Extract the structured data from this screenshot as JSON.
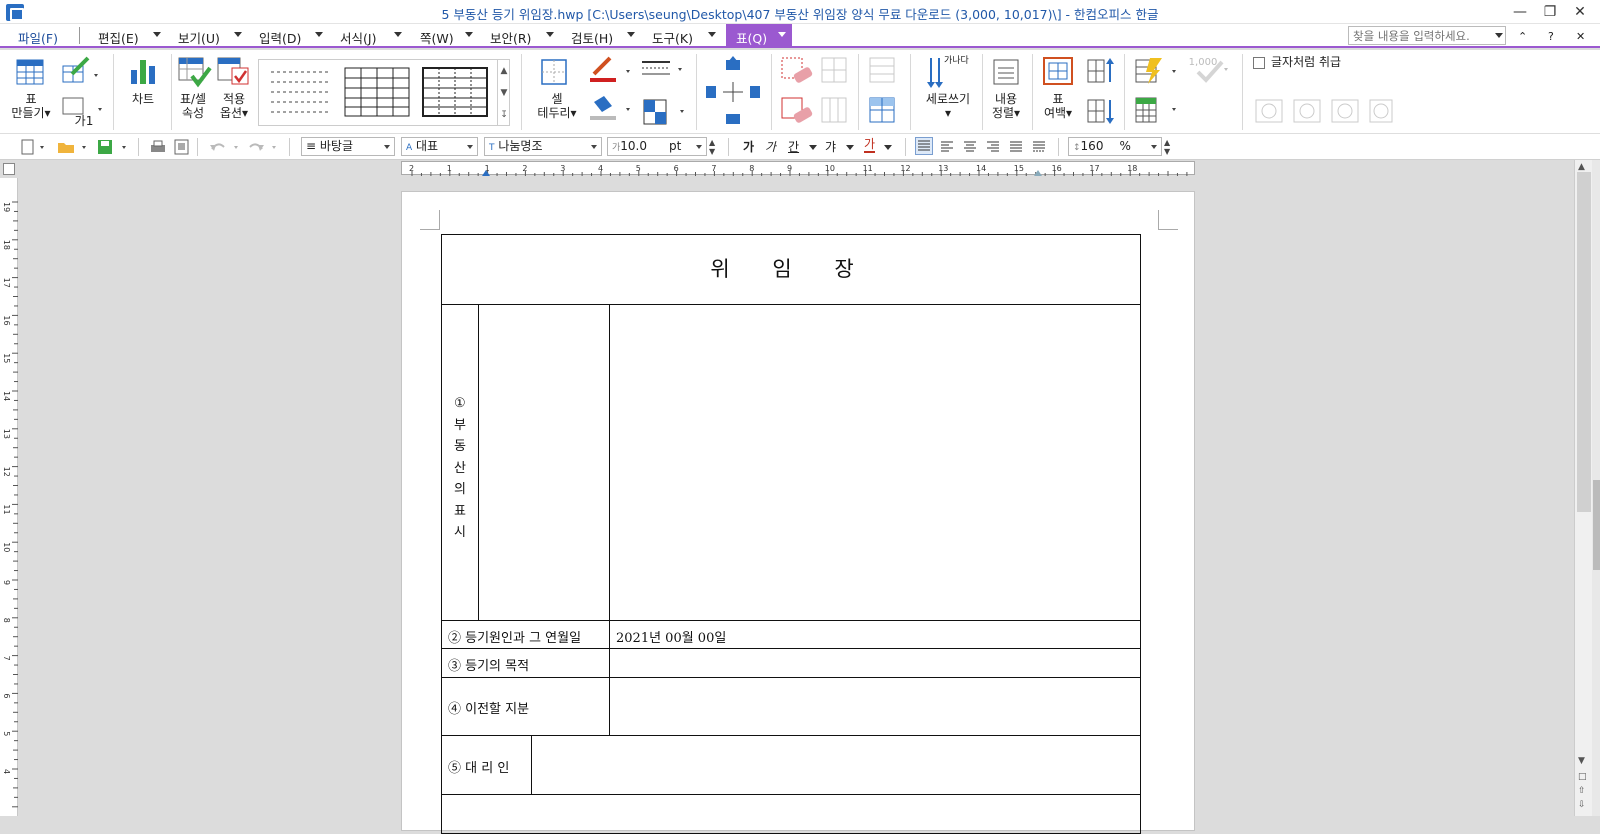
{
  "window": {
    "title": "5 부동산 등기 위임장.hwp [C:\\Users\\seung\\Desktop\\407 부동산 위임장 양식  무료 다운로드 (3,000, 10,017)\\] - 한컴오피스 한글"
  },
  "menu": {
    "file": "파일(F)",
    "edit": "편집(E)",
    "view": "보기(U)",
    "insert": "입력(D)",
    "format": "서식(J)",
    "page": "쪽(W)",
    "security": "보안(R)",
    "review": "검토(H)",
    "tools": "도구(K)",
    "table": "표(Q)",
    "search_placeholder": "찾을 내용을 입력하세요."
  },
  "ribbon": {
    "make_table_1": "표",
    "make_table_2": "만들기",
    "chart": "차트",
    "cell_props_1": "표/셀",
    "cell_props_2": "속성",
    "apply_opt_1": "적용",
    "apply_opt_2": "옵션",
    "cell_border_1": "셀",
    "cell_border_2": "테두리",
    "vertical_write": "세로쓰기",
    "content_align_1": "내용",
    "content_align_2": "정렬",
    "table_margin_1": "표",
    "table_margin_2": "여백",
    "ga1": "가1",
    "ganada": "가나다",
    "number_1000": "1,000",
    "treat_as_char": "글자처럼 취급"
  },
  "quickbar": {
    "style": "바탕글",
    "lang": "대표",
    "font": "나눔명조",
    "size": "10.0",
    "unit": "pt",
    "zoom": "160",
    "zoom_unit": "%"
  },
  "ruler": {
    "h_ticks": [
      "2",
      "1",
      "1",
      "2",
      "3",
      "4",
      "5",
      "6",
      "7",
      "8",
      "9",
      "10",
      "11",
      "12",
      "13",
      "14",
      "15",
      "16",
      "17",
      "18"
    ],
    "v_ticks": [
      "19",
      "18",
      "17",
      "16",
      "15",
      "14",
      "13",
      "12",
      "11",
      "10",
      "9",
      "8",
      "7",
      "6",
      "5",
      "4"
    ]
  },
  "document": {
    "title": "위  임  장",
    "row1_label": "① 부동산의 표시",
    "row1_chars": [
      "①",
      "부",
      "동",
      "산",
      "의",
      "표",
      "시"
    ],
    "row2_label": "② 등기원인과 그 연월일",
    "row2_value": "2021년 00월 00일",
    "row3_label": "③ 등기의 목적",
    "row4_label": "④ 이전할 지분",
    "row5_label": "⑤ 대 리 인"
  },
  "colors": {
    "accent": "#9b59d0",
    "title_blue": "#2158a8"
  }
}
